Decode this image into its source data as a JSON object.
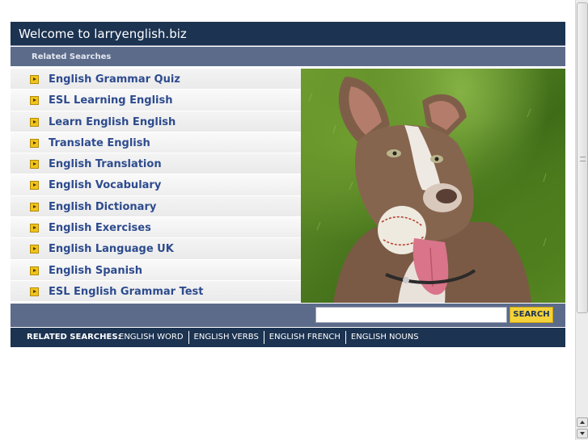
{
  "header": {
    "title": "Welcome to larryenglish.biz"
  },
  "subheader": {
    "label": "Related Searches"
  },
  "links": [
    {
      "label": "English Grammar Quiz"
    },
    {
      "label": "ESL Learning English"
    },
    {
      "label": "Learn English English"
    },
    {
      "label": "Translate English"
    },
    {
      "label": "English Translation"
    },
    {
      "label": "English Vocabulary"
    },
    {
      "label": "English Dictionary"
    },
    {
      "label": "English Exercises"
    },
    {
      "label": "English Language UK"
    },
    {
      "label": "English Spanish"
    },
    {
      "label": "ESL English Grammar Test"
    }
  ],
  "search": {
    "value": "",
    "button_label": "SEARCH"
  },
  "footer": {
    "label": "RELATED SEARCHES:",
    "links": [
      {
        "label": "ENGLISH WORD"
      },
      {
        "label": "ENGLISH VERBS"
      },
      {
        "label": "ENGLISH FRENCH"
      },
      {
        "label": "ENGLISH NOUNS"
      }
    ]
  },
  "icons": {
    "link_bullet": "arrow-right-icon",
    "scroll_up": "chevron-up-icon",
    "scroll_down": "chevron-down-icon"
  },
  "colors": {
    "header_bg": "#1c3351",
    "subheader_bg": "#5c6b8a",
    "link_text": "#2d4b8e",
    "bullet": "#f0c419",
    "search_button": "#f4d23a"
  }
}
